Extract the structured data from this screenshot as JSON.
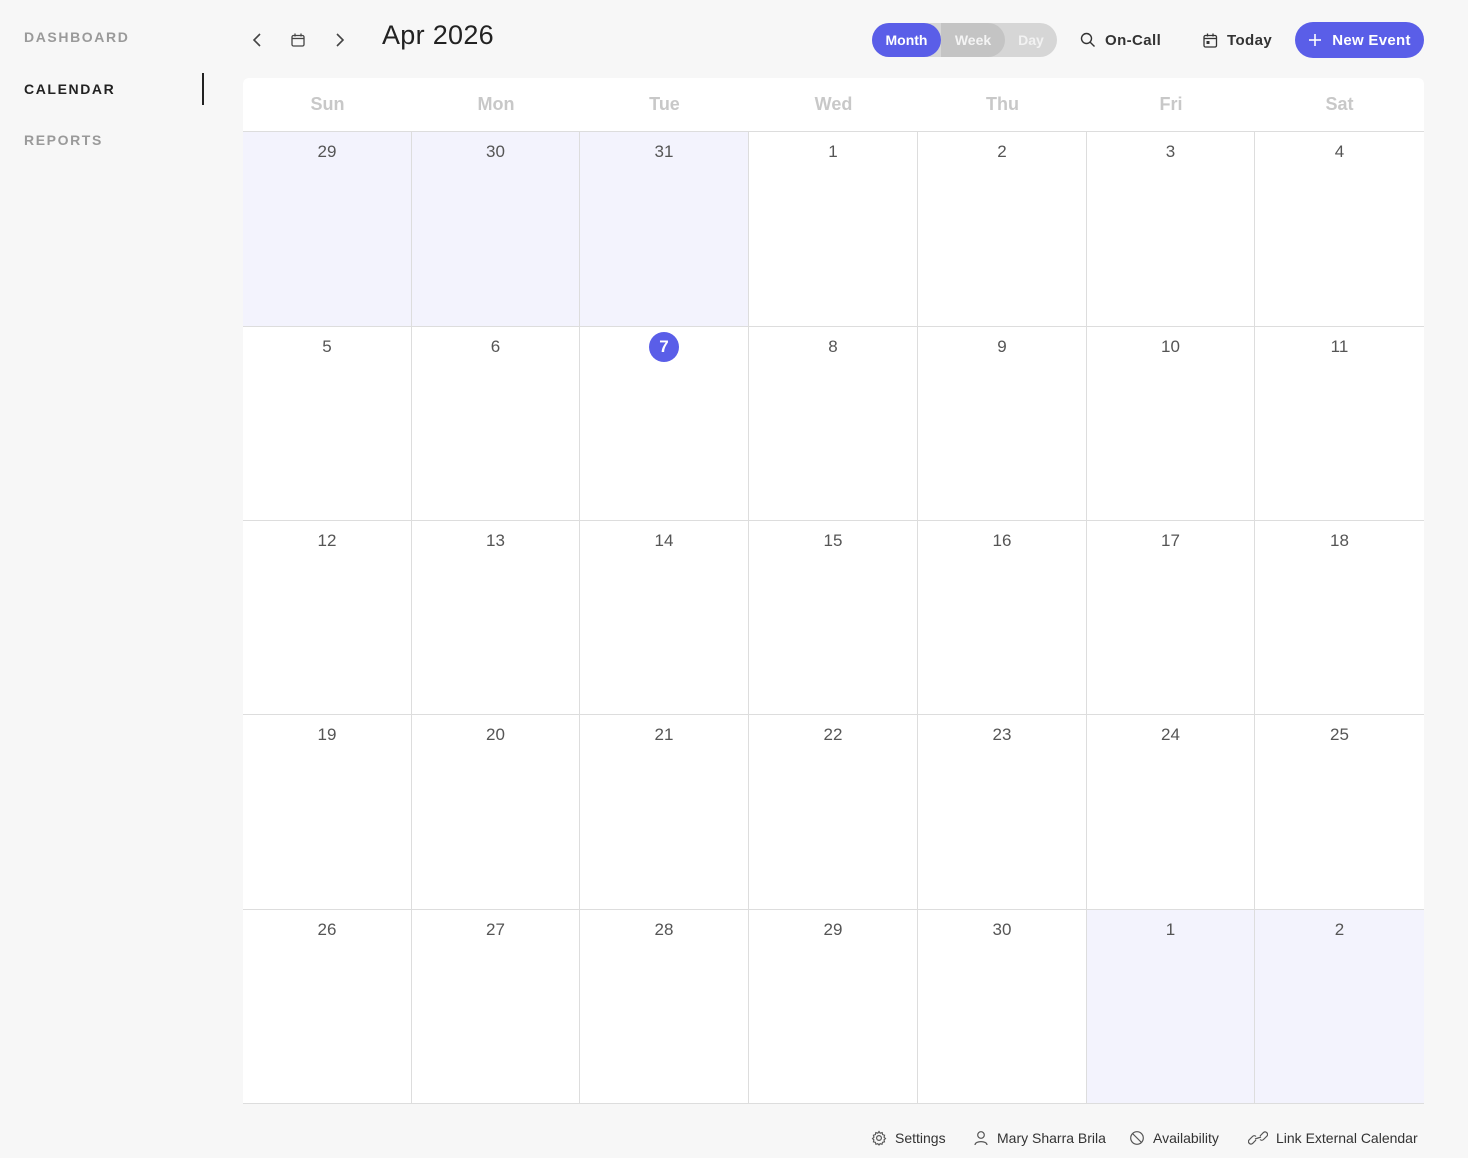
{
  "sidebar": {
    "items": [
      {
        "label": "DASHBOARD",
        "active": false
      },
      {
        "label": "CALENDAR",
        "active": true
      },
      {
        "label": "REPORTS",
        "active": false
      }
    ]
  },
  "header": {
    "month_title": "Apr 2026",
    "view_toggle": {
      "month": "Month",
      "week": "Week",
      "day": "Day",
      "selected": "Month"
    },
    "on_call_label": "On-Call",
    "today_label": "Today",
    "new_event_label": "New Event",
    "accent_color": "#5a5ee8"
  },
  "calendar": {
    "weekdays": [
      "Sun",
      "Mon",
      "Tue",
      "Wed",
      "Thu",
      "Fri",
      "Sat"
    ],
    "weeks": [
      [
        {
          "day": "29",
          "outside": true
        },
        {
          "day": "30",
          "outside": true
        },
        {
          "day": "31",
          "outside": true
        },
        {
          "day": "1"
        },
        {
          "day": "2"
        },
        {
          "day": "3"
        },
        {
          "day": "4"
        }
      ],
      [
        {
          "day": "5"
        },
        {
          "day": "6"
        },
        {
          "day": "7",
          "today": true
        },
        {
          "day": "8"
        },
        {
          "day": "9"
        },
        {
          "day": "10"
        },
        {
          "day": "11"
        }
      ],
      [
        {
          "day": "12"
        },
        {
          "day": "13"
        },
        {
          "day": "14"
        },
        {
          "day": "15"
        },
        {
          "day": "16"
        },
        {
          "day": "17"
        },
        {
          "day": "18"
        }
      ],
      [
        {
          "day": "19"
        },
        {
          "day": "20"
        },
        {
          "day": "21"
        },
        {
          "day": "22"
        },
        {
          "day": "23"
        },
        {
          "day": "24"
        },
        {
          "day": "25"
        }
      ],
      [
        {
          "day": "26"
        },
        {
          "day": "27"
        },
        {
          "day": "28"
        },
        {
          "day": "29"
        },
        {
          "day": "30"
        },
        {
          "day": "1",
          "outside": true
        },
        {
          "day": "2",
          "outside": true
        }
      ]
    ]
  },
  "footer": {
    "settings_label": "Settings",
    "user_name": "Mary Sharra Brila",
    "availability_label": "Availability",
    "link_calendar_label": "Link External Calendar"
  }
}
